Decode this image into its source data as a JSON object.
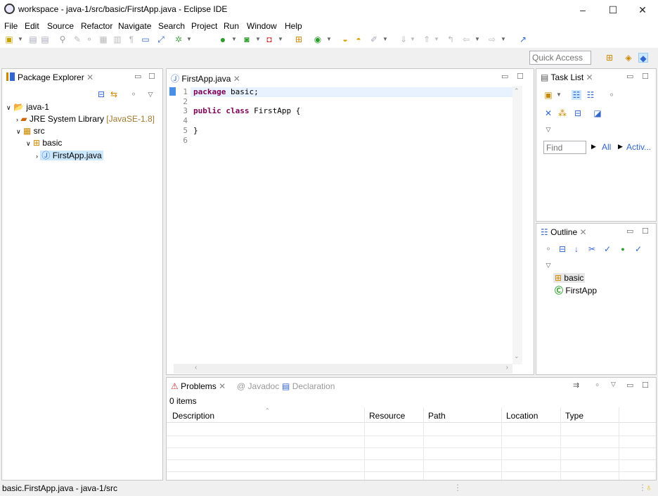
{
  "window": {
    "title": "workspace - java-1/src/basic/FirstApp.java - Eclipse IDE",
    "min": "–",
    "max": "☐",
    "close": "✕"
  },
  "menu": [
    "File",
    "Edit",
    "Source",
    "Refactor",
    "Navigate",
    "Search",
    "Project",
    "Run",
    "Window",
    "Help"
  ],
  "quick_access": {
    "placeholder": "Quick Access"
  },
  "package_explorer": {
    "tab": "Package Explorer",
    "tree": {
      "project": "java-1",
      "jre": "JRE System Library",
      "jre_version": "[JavaSE-1.8]",
      "src": "src",
      "package": "basic",
      "file": "FirstApp.java"
    }
  },
  "editor": {
    "tab": "FirstApp.java",
    "lines": [
      {
        "n": "1",
        "kw": "package",
        "rest": " basic;"
      },
      {
        "n": "2",
        "kw": "",
        "rest": ""
      },
      {
        "n": "3",
        "kw": "public class",
        "rest": " FirstApp {"
      },
      {
        "n": "4",
        "kw": "",
        "rest": ""
      },
      {
        "n": "5",
        "kw": "",
        "rest": "}"
      },
      {
        "n": "6",
        "kw": "",
        "rest": ""
      }
    ]
  },
  "task_list": {
    "tab": "Task List",
    "find_placeholder": "Find",
    "all": "All",
    "activ": "Activ..."
  },
  "outline": {
    "tab": "Outline",
    "items": [
      "basic",
      "FirstApp"
    ]
  },
  "bottom": {
    "tabs": {
      "problems": "Problems",
      "javadoc": "Javadoc",
      "declaration": "Declaration"
    },
    "count": "0 items",
    "columns": [
      "Description",
      "Resource",
      "Path",
      "Location",
      "Type"
    ]
  },
  "status": {
    "text": "basic.FirstApp.java - java-1/src"
  },
  "colors": {
    "selection": "#cce8ff",
    "keyword": "#7f0055",
    "accent": "#3c6eb4"
  }
}
